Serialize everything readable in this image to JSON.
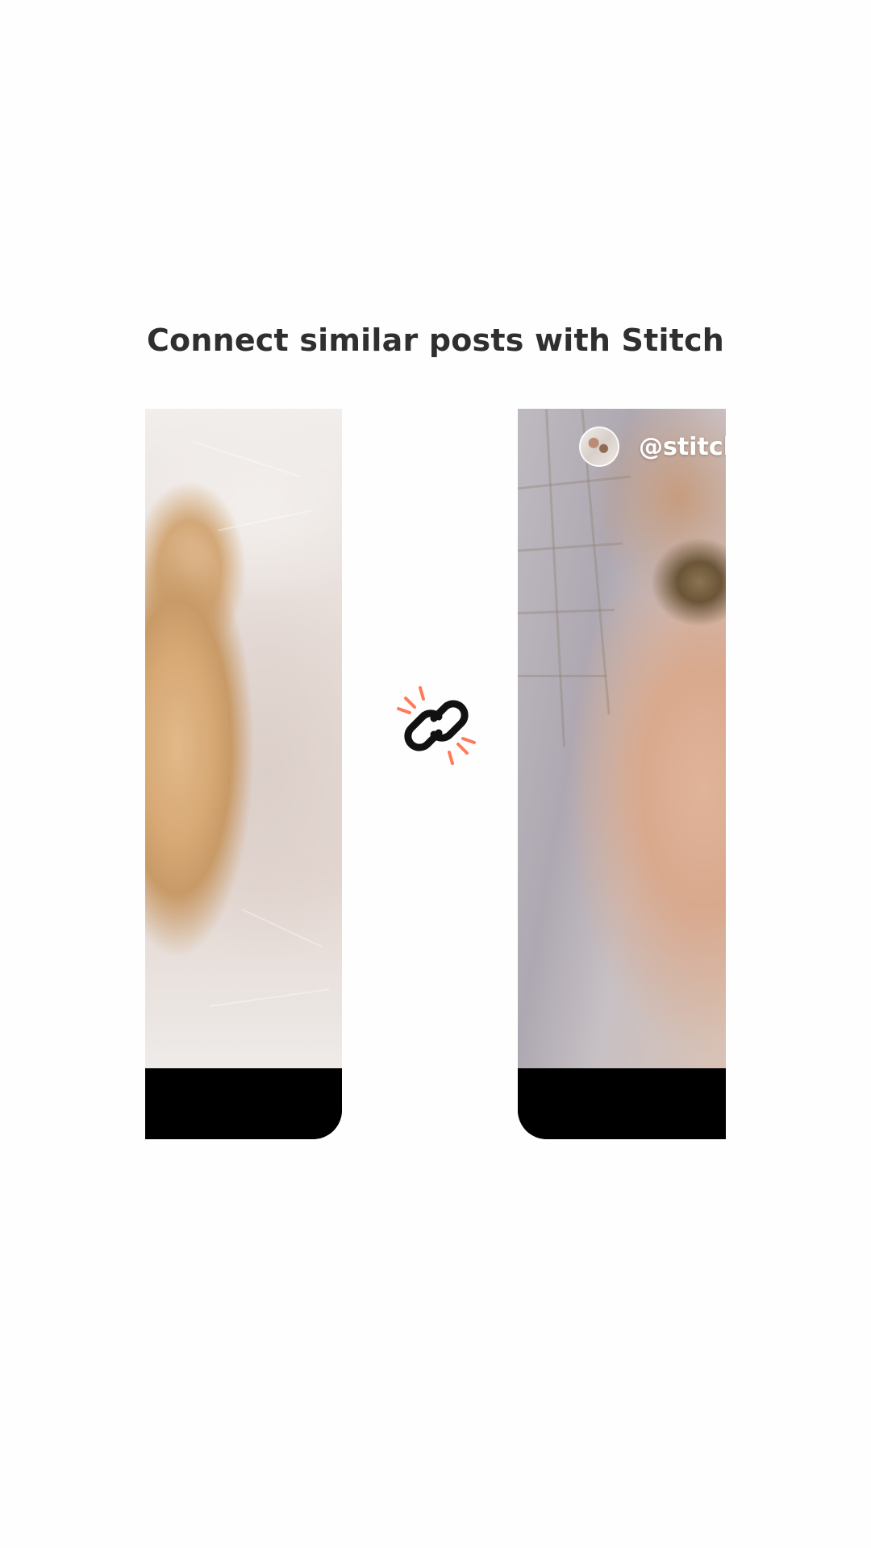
{
  "title": "Connect similar posts with Stitch",
  "right_card": {
    "handle": "@stitch"
  },
  "icons": {
    "center": "link-icon",
    "spark_color": "#ff7a59",
    "chain_color": "#111111"
  },
  "colors": {
    "background": "#fefefe",
    "title_text": "#2f2f2f",
    "card_bar": "#000000"
  }
}
